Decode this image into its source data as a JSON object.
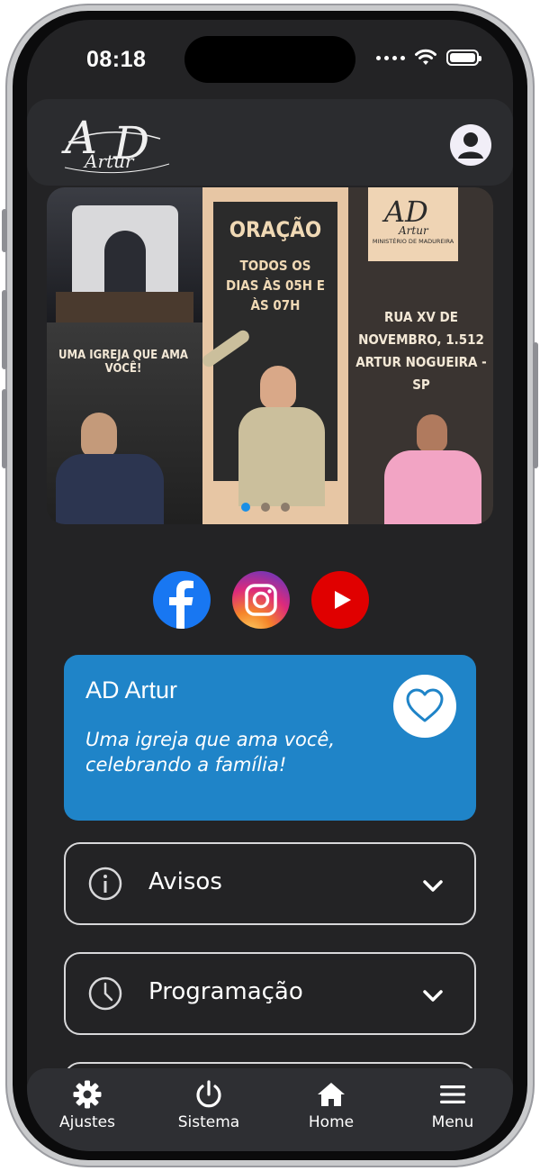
{
  "status_bar": {
    "time": "08:18"
  },
  "header": {
    "logo_alt": "AD Artur"
  },
  "banner": {
    "left_panel": {
      "slogan": "UMA IGREJA QUE AMA VOCÊ!"
    },
    "mid_panel": {
      "heading": "ORAÇÃO",
      "schedule": "TODOS OS DIAS ÀS 05H E ÀS 07H"
    },
    "right_panel": {
      "logo_sub": "MINISTÉRIO DE MADUREIRA",
      "address": "RUA XV DE NOVEMBRO, 1.512 ARTUR NOGUEIRA -SP"
    },
    "pager_count": 3,
    "pager_active": 0
  },
  "social": [
    {
      "name": "facebook",
      "color": "#1877f2"
    },
    {
      "name": "instagram",
      "color": "#e1306c"
    },
    {
      "name": "youtube",
      "color": "#e00000"
    }
  ],
  "info_card": {
    "title": "AD Artur",
    "subtitle": "Uma igreja que ama você, celebrando a família!",
    "color": "#1f84c8"
  },
  "accordions": [
    {
      "label": "Avisos",
      "icon": "info-icon"
    },
    {
      "label": "Programação",
      "icon": "clock-icon"
    }
  ],
  "tabbar": {
    "items": [
      {
        "label": "Ajustes",
        "icon": "gear-icon"
      },
      {
        "label": "Sistema",
        "icon": "power-icon"
      },
      {
        "label": "Home",
        "icon": "home-icon"
      },
      {
        "label": "Menu",
        "icon": "menu-icon"
      }
    ]
  }
}
